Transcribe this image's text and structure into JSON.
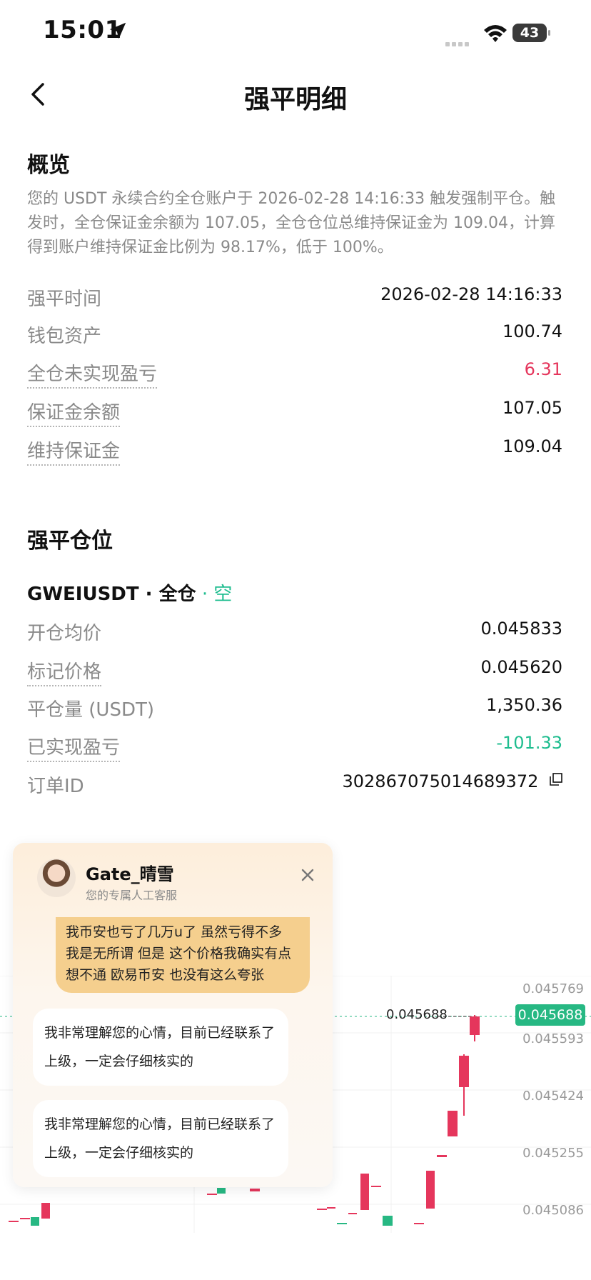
{
  "status_bar": {
    "time": "15:01",
    "battery": "43"
  },
  "nav": {
    "title": "强平明细"
  },
  "overview": {
    "title": "概览",
    "description": "您的 USDT 永续合约全仓账户于 2026-02-28 14:16:33 触发强制平仓。触发时，全仓保证金余额为 107.05，全仓仓位总维持保证金为 109.04，计算得到账户维持保证金比例为 98.17%，低于 100%。",
    "rows": [
      {
        "label": "强平时间",
        "value": "2026-02-28 14:16:33"
      },
      {
        "label": "钱包资产",
        "value": "100.74"
      },
      {
        "label": "全仓未实现盈亏",
        "value": "6.31"
      },
      {
        "label": "保证金余额",
        "value": "107.05"
      },
      {
        "label": "维持保证金",
        "value": "109.04"
      }
    ]
  },
  "position": {
    "title": "强平仓位",
    "symbol": "GWEIUSDT",
    "mode": " · 全仓",
    "side": " · 空",
    "rows": [
      {
        "label": "开仓均价",
        "value": "0.045833"
      },
      {
        "label": "标记价格",
        "value": "0.045620"
      },
      {
        "label": "平仓量 (USDT)",
        "value": "1,350.36"
      },
      {
        "label": "已实现盈亏",
        "value": "-101.33"
      },
      {
        "label": "订单ID",
        "value": "302867075014689372"
      }
    ]
  },
  "chart": {
    "y_labels": [
      "0.045769",
      "0.045593",
      "0.045424",
      "0.045255",
      "0.045086"
    ],
    "last_price": "0.045688",
    "current_price": "0.045688"
  },
  "chat": {
    "agent_name": "Gate_晴雪",
    "agent_subtitle": "您的专属人工客服",
    "user_message": "我币安也亏了几万u了 虽然亏得不多 我是无所谓 但是 这个价格我确实有点想不通 欧易币安 也没有这么夸张",
    "agent_messages": [
      "我非常理解您的心情，目前已经联系了上级，一定会仔细核实的",
      "我非常理解您的心情，目前已经联系了上级，一定会仔细核实的"
    ]
  },
  "colors": {
    "red": "#e5365c",
    "green": "#1fbd8f",
    "gray": "#8a8a8a"
  }
}
